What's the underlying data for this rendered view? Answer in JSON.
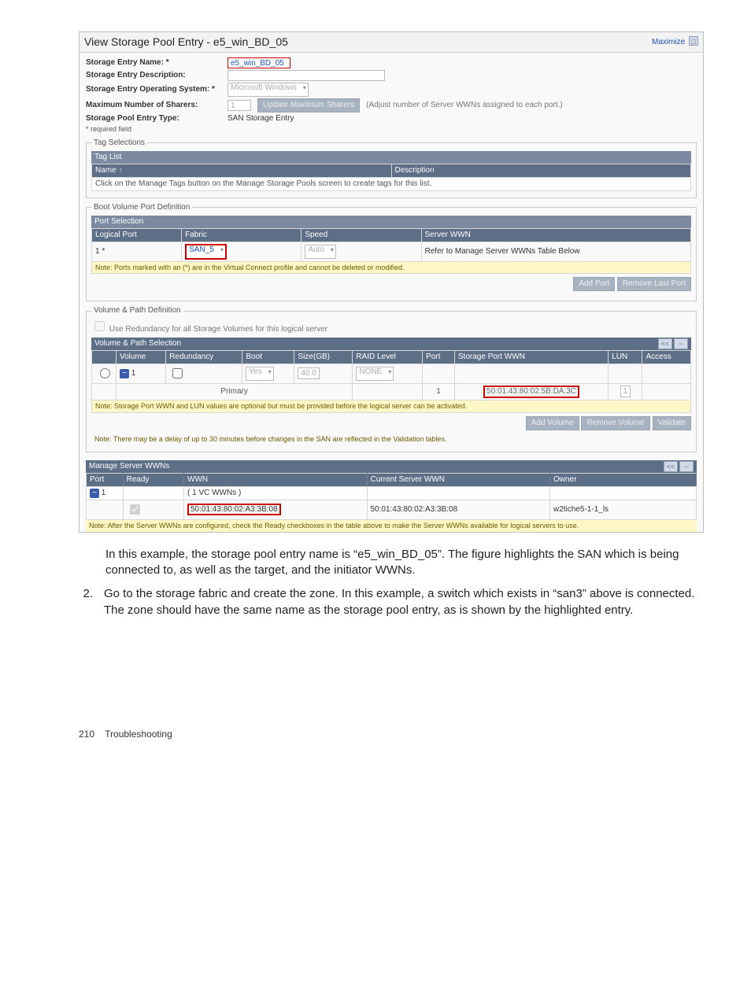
{
  "top": {
    "title": "View Storage Pool Entry - e5_win_BD_05",
    "maximize": "Maximize"
  },
  "form": {
    "entry_name_lbl": "Storage Entry Name: *",
    "entry_name_val": "e5_win_BD_05",
    "entry_desc_lbl": "Storage Entry Description:",
    "os_lbl": "Storage Entry Operating System: *",
    "os_val": "Microsoft Windows",
    "max_sharers_lbl": "Maximum Number of Sharers:",
    "max_sharers_val": "1",
    "update_btn": "Update Maximum Sharers",
    "adjust_hint": "(Adjust number of Server WWNs assigned to each port.)",
    "type_lbl": "Storage Pool Entry Type:",
    "type_val": "SAN Storage Entry",
    "required_note": "* required field"
  },
  "tags": {
    "legend": "Tag Selections",
    "list_bar": "Tag List",
    "name_col": "Name",
    "desc_col": "Description",
    "note": "Click on the Manage Tags button on the Manage Storage Pools screen to create tags for this list."
  },
  "boot": {
    "legend": "Boot Volume Port Definition",
    "bar": "Port Selection",
    "cols": {
      "logical": "Logical Port",
      "fabric": "Fabric",
      "speed": "Speed",
      "server_wwn": "Server WWN"
    },
    "row": {
      "logical": "1 *",
      "fabric": "SAN_5",
      "speed": "Auto",
      "server_wwn": "Refer to Manage Server WWNs Table Below"
    },
    "note": "Note: Ports marked with an (*) are in the Virtual Connect profile and cannot be deleted or modified.",
    "add_btn": "Add Port",
    "remove_btn": "Remove Last Port"
  },
  "vol": {
    "legend": "Volume & Path Definition",
    "redund_check": "Use Redundancy for all Storage Volumes for this logical server",
    "bar": "Volume & Path Selection",
    "cols": {
      "volume": "Volume",
      "redundancy": "Redundancy",
      "boot": "Boot",
      "size": "Size(GB)",
      "raid": "RAID Level",
      "port": "Port",
      "sp_wwn": "Storage Port WWN",
      "lun": "LUN",
      "access": "Access"
    },
    "row": {
      "vol_num": "1",
      "redund_val": "Yes",
      "size_val": "40.0",
      "raid_val": "NONE",
      "primary_label": "Primary",
      "port_val": "1",
      "sp_wwn_val": "50:01:43:80:02:5B:DA:3C",
      "lun_val": "1"
    },
    "note1": "Note: Storage Port WWN and LUN values are optional but must be provided before the logical server can be activated.",
    "add_btn": "Add Volume",
    "remove_btn": "Remove Volume",
    "validate_btn": "Validate",
    "note2": "Note: There may be a delay of up to 30 minutes before changes in the SAN are reflected in the Validation tables."
  },
  "wwns": {
    "bar": "Manage Server WWNs",
    "cols": {
      "port": "Port",
      "ready": "Ready",
      "wwn": "WWN",
      "current": "Current Server WWN",
      "owner": "Owner"
    },
    "row": {
      "port": "1",
      "vc_label": "( 1 VC WWNs )",
      "wwn_val": "50:01:43:80:02:A3:3B:08",
      "current_val": "50:01:43:80:02:A3:3B:08",
      "owner_val": "w2tiche5-1-1_ls"
    },
    "note": "Note: After the Server WWNs are configured, check the Ready checkboxes in the table above to make the Server WWNs available for logical servers to use."
  },
  "doc": {
    "para1": "In this example, the storage pool entry name is “e5_win_BD_05”. The figure highlights the SAN which is being connected to, as well as the target, and the initiator WWNs.",
    "step_num": "2.",
    "step_text": "Go to the storage fabric and create the zone. In this example, a switch which exists in “san3” above is connected. The zone should have the same name as the storage pool entry, as is shown by the highlighted entry.",
    "footer_page": "210",
    "footer_title": "Troubleshooting"
  }
}
